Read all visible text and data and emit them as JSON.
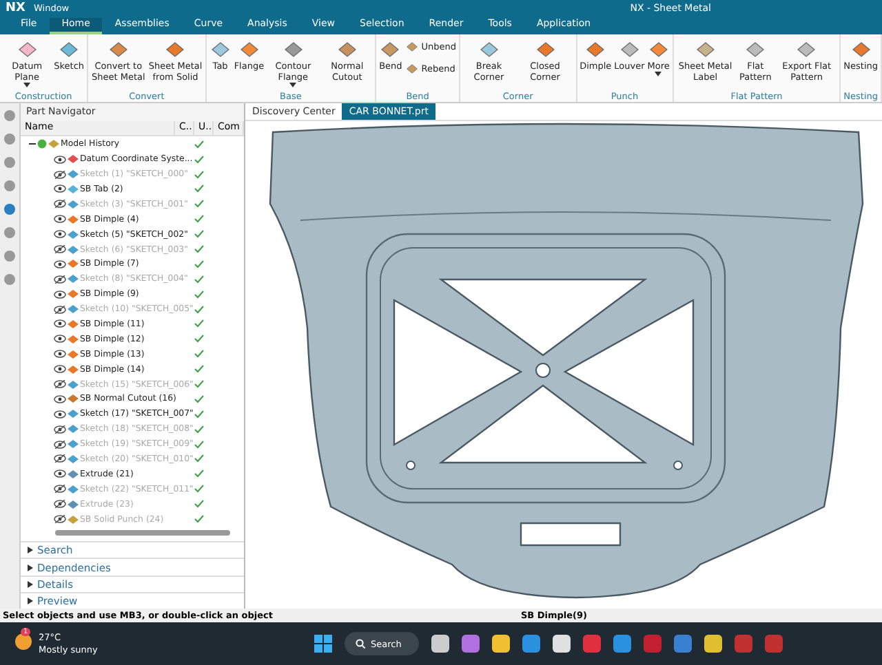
{
  "title_bar": {
    "app": "NX",
    "window_menu": "Window",
    "title": "NX - Sheet Metal"
  },
  "menu_tabs": [
    {
      "label": "File",
      "selected": false
    },
    {
      "label": "Home",
      "selected": true
    },
    {
      "label": "Assemblies",
      "selected": false
    },
    {
      "label": "Curve",
      "selected": false
    },
    {
      "label": "Analysis",
      "selected": false
    },
    {
      "label": "View",
      "selected": false
    },
    {
      "label": "Selection",
      "selected": false
    },
    {
      "label": "Render",
      "selected": false
    },
    {
      "label": "Tools",
      "selected": false
    },
    {
      "label": "Application",
      "selected": false
    }
  ],
  "ribbon_groups": [
    {
      "label": "Construction",
      "commands": [
        {
          "label": "Datum Plane",
          "kind": "large",
          "dropdown": true
        },
        {
          "label": "Sketch",
          "kind": "large",
          "dropdown": false
        }
      ]
    },
    {
      "label": "Convert",
      "commands": [
        {
          "label": "Convert to Sheet Metal",
          "kind": "large",
          "dropdown": false
        },
        {
          "label": "Sheet Metal from Solid",
          "kind": "large",
          "dropdown": false
        }
      ]
    },
    {
      "label": "Base",
      "commands": [
        {
          "label": "Tab",
          "kind": "large",
          "dropdown": false
        },
        {
          "label": "Flange",
          "kind": "large",
          "dropdown": false
        },
        {
          "label": "Contour Flange",
          "kind": "large",
          "dropdown": true
        },
        {
          "label": "Normal Cutout",
          "kind": "large",
          "dropdown": false
        }
      ]
    },
    {
      "label": "Bend",
      "commands": [
        {
          "label": "Bend",
          "kind": "large",
          "dropdown": false
        },
        {
          "label": "Unbend",
          "kind": "small",
          "dropdown": false
        },
        {
          "label": "Rebend",
          "kind": "small",
          "dropdown": false
        }
      ]
    },
    {
      "label": "Corner",
      "commands": [
        {
          "label": "Break Corner",
          "kind": "large",
          "dropdown": false
        },
        {
          "label": "Closed Corner",
          "kind": "large",
          "dropdown": false
        }
      ]
    },
    {
      "label": "Punch",
      "commands": [
        {
          "label": "Dimple",
          "kind": "large",
          "dropdown": false
        },
        {
          "label": "Louver",
          "kind": "large",
          "dropdown": false
        },
        {
          "label": "More",
          "kind": "large",
          "dropdown": true
        }
      ]
    },
    {
      "label": "Flat Pattern",
      "commands": [
        {
          "label": "Sheet Metal Label",
          "kind": "large",
          "dropdown": false
        },
        {
          "label": "Flat Pattern",
          "kind": "large",
          "dropdown": false
        },
        {
          "label": "Export Flat Pattern",
          "kind": "large",
          "dropdown": false
        }
      ]
    },
    {
      "label": "Nesting",
      "commands": [
        {
          "label": "Nesting",
          "kind": "large",
          "dropdown": false
        }
      ]
    }
  ],
  "part_navigator": {
    "title": "Part Navigator",
    "columns": [
      "Name",
      "C...",
      "U...",
      "Com"
    ],
    "root": {
      "label": "Model History",
      "expanded": true,
      "children": [
        {
          "label": "Datum Coordinate Syste...",
          "kind": "datum",
          "suppressed": false
        },
        {
          "label": "Sketch (1) \"SKETCH_000\"",
          "kind": "sketch",
          "suppressed": true
        },
        {
          "label": "SB Tab (2)",
          "kind": "tab",
          "suppressed": false
        },
        {
          "label": "Sketch (3) \"SKETCH_001\"",
          "kind": "sketch",
          "suppressed": true
        },
        {
          "label": "SB Dimple (4)",
          "kind": "dimple",
          "suppressed": false
        },
        {
          "label": "Sketch (5) \"SKETCH_002\"",
          "kind": "sketch",
          "suppressed": false
        },
        {
          "label": "Sketch (6) \"SKETCH_003\"",
          "kind": "sketch",
          "suppressed": true
        },
        {
          "label": "SB Dimple (7)",
          "kind": "dimple",
          "suppressed": false
        },
        {
          "label": "Sketch (8) \"SKETCH_004\"",
          "kind": "sketch",
          "suppressed": true
        },
        {
          "label": "SB Dimple (9)",
          "kind": "dimple",
          "suppressed": false
        },
        {
          "label": "Sketch (10) \"SKETCH_005\"",
          "kind": "sketch",
          "suppressed": true
        },
        {
          "label": "SB Dimple (11)",
          "kind": "dimple",
          "suppressed": false
        },
        {
          "label": "SB Dimple (12)",
          "kind": "dimple",
          "suppressed": false
        },
        {
          "label": "SB Dimple (13)",
          "kind": "dimple",
          "suppressed": false
        },
        {
          "label": "SB Dimple (14)",
          "kind": "dimple",
          "suppressed": false
        },
        {
          "label": "Sketch (15) \"SKETCH_006\"",
          "kind": "sketch",
          "suppressed": true
        },
        {
          "label": "SB Normal Cutout (16)",
          "kind": "cutout",
          "suppressed": false
        },
        {
          "label": "Sketch (17) \"SKETCH_007\"",
          "kind": "sketch",
          "suppressed": false
        },
        {
          "label": "Sketch (18) \"SKETCH_008\"",
          "kind": "sketch",
          "suppressed": true
        },
        {
          "label": "Sketch (19) \"SKETCH_009\"",
          "kind": "sketch",
          "suppressed": true
        },
        {
          "label": "Sketch (20) \"SKETCH_010\"",
          "kind": "sketch",
          "suppressed": true
        },
        {
          "label": "Extrude (21)",
          "kind": "extrude",
          "suppressed": false
        },
        {
          "label": "Sketch (22) \"SKETCH_011\"",
          "kind": "sketch",
          "suppressed": true
        },
        {
          "label": "Extrude (23)",
          "kind": "extrude",
          "suppressed": true
        },
        {
          "label": "SB Solid Punch (24)",
          "kind": "punch",
          "suppressed": true
        }
      ]
    },
    "sections": [
      "Search",
      "Dependencies",
      "Details",
      "Preview"
    ]
  },
  "graphics_tabs": [
    {
      "label": "Discovery Center",
      "selected": false
    },
    {
      "label": "CAR BONNET.prt",
      "selected": true
    }
  ],
  "status_bar": {
    "prompt": "Select objects and use MB3, or double-click an object",
    "selection": "SB Dimple(9)"
  },
  "taskbar": {
    "weather": {
      "badge": "1",
      "temperature": "27°C",
      "condition": "Mostly sunny"
    },
    "search": "Search"
  }
}
